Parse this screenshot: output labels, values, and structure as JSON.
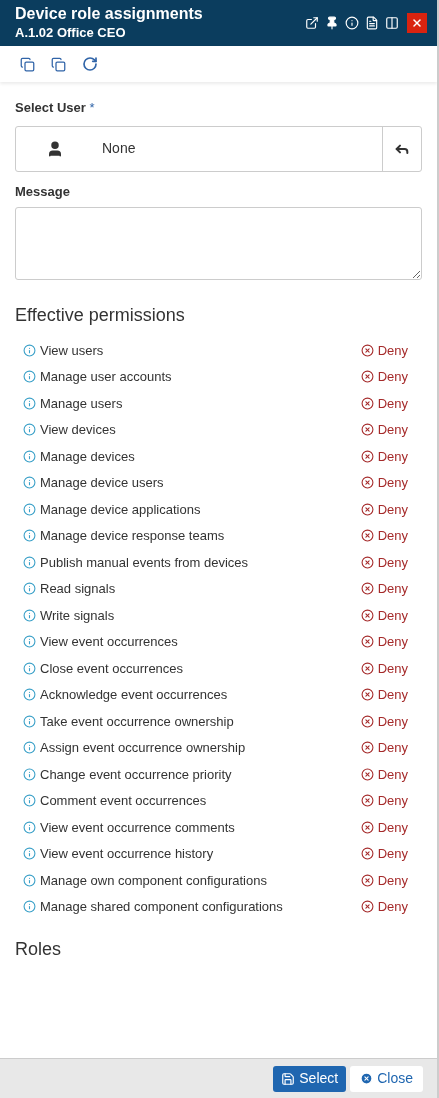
{
  "window": {
    "title": "Device role assignments",
    "subtitle": "A.1.02 Office CEO"
  },
  "select_user": {
    "label": "Select User",
    "required_mark": "*",
    "value": "None"
  },
  "message": {
    "label": "Message"
  },
  "effective_permissions": {
    "heading": "Effective permissions",
    "items": [
      {
        "name": "View users",
        "kind": "deny",
        "result": "Deny"
      },
      {
        "name": "Manage user accounts",
        "kind": "deny",
        "result": "Deny"
      },
      {
        "name": "Manage users",
        "kind": "deny",
        "result": "Deny"
      },
      {
        "name": "View devices",
        "kind": "deny",
        "result": "Deny"
      },
      {
        "name": "Manage devices",
        "kind": "deny",
        "result": "Deny"
      },
      {
        "name": "Manage device users",
        "kind": "deny",
        "result": "Deny"
      },
      {
        "name": "Manage device applications",
        "kind": "deny",
        "result": "Deny"
      },
      {
        "name": "Manage device response teams",
        "kind": "deny",
        "result": "Deny"
      },
      {
        "name": "Publish manual events from devices",
        "kind": "deny",
        "result": "Deny"
      },
      {
        "name": "Read signals",
        "kind": "deny",
        "result": "Deny"
      },
      {
        "name": "Write signals",
        "kind": "deny",
        "result": "Deny"
      },
      {
        "name": "View event occurrences",
        "kind": "deny",
        "result": "Deny"
      },
      {
        "name": "Close event occurrences",
        "kind": "deny",
        "result": "Deny"
      },
      {
        "name": "Acknowledge event occurrences",
        "kind": "deny",
        "result": "Deny"
      },
      {
        "name": "Take event occurrence ownership",
        "kind": "deny",
        "result": "Deny"
      },
      {
        "name": "Assign event occurrence ownership",
        "kind": "deny",
        "result": "Deny"
      },
      {
        "name": "Change event occurrence priority",
        "kind": "deny",
        "result": "Deny"
      },
      {
        "name": "Comment event occurrences",
        "kind": "deny",
        "result": "Deny"
      },
      {
        "name": "View event occurrence comments",
        "kind": "deny",
        "result": "Deny"
      },
      {
        "name": "View event occurrence history",
        "kind": "deny",
        "result": "Deny"
      },
      {
        "name": "Manage own component configurations",
        "kind": "deny",
        "result": "Deny"
      },
      {
        "name": "Manage shared component configurations",
        "kind": "deny",
        "result": "Deny"
      }
    ]
  },
  "roles": {
    "heading": "Roles"
  },
  "footer": {
    "buttons": [
      {
        "label": "Select",
        "kind": "primary"
      },
      {
        "label": "Close",
        "kind": "secondary"
      }
    ]
  }
}
